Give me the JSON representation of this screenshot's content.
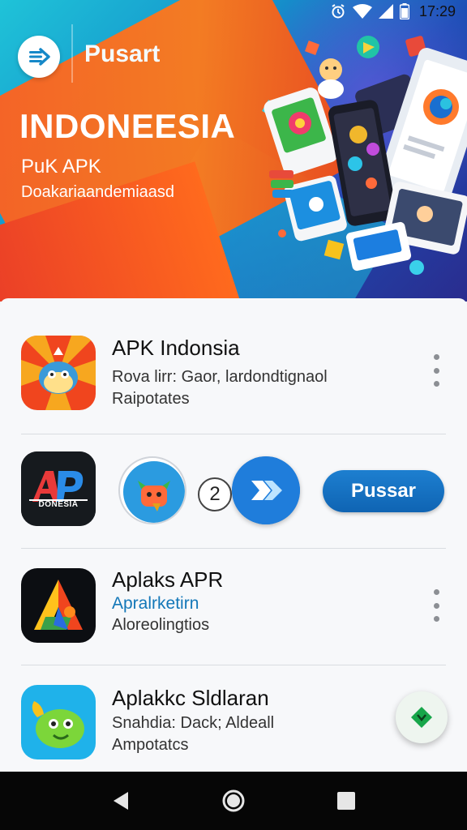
{
  "status_bar": {
    "time": "17:29",
    "icons": [
      "alarm-icon",
      "wifi-icon",
      "signal-icon",
      "battery-icon"
    ]
  },
  "hero": {
    "brand": "Pusart",
    "title": "INDONEESIA",
    "subtitle_1": "PuK APK",
    "subtitle_2": "Doakariaandemiaasd",
    "accent_colors": [
      "#1fc3d8",
      "#1c4fb6",
      "#ff5a1f"
    ]
  },
  "apps": [
    {
      "name": "APK Indonsia",
      "line_1": "Rova lirr: Gaor, lardondtignaol",
      "line_2": "Raipotates",
      "icon": "mascot-app-icon"
    },
    {
      "name": "Aplaks APR",
      "line_1": "Apralrketirn",
      "line_2": "Aloreolingtios",
      "icon": "colorful-a-app-icon"
    },
    {
      "name": "Aplakkc Sldlaran",
      "line_1": "Snahdia: Dack; Aldeall",
      "line_2": "Ampotatcs",
      "icon": "green-creature-app-icon"
    }
  ],
  "featured_row": {
    "logo_text": "DONESIA",
    "badge_number": "2",
    "button_label": "Pussar",
    "button_color": "#1570c2"
  },
  "nav_bar": {
    "buttons": [
      "back-icon",
      "home-icon",
      "recents-icon"
    ]
  }
}
